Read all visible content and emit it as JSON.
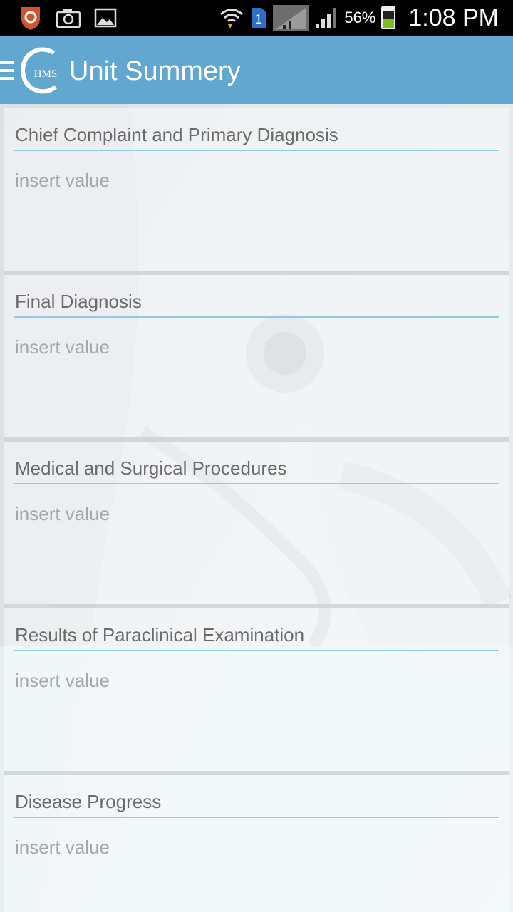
{
  "status_bar": {
    "icons_left": [
      "shield-app-icon",
      "camera-icon",
      "image-icon"
    ],
    "icons_right": [
      "wifi-icon",
      "sim-1-icon",
      "signal-icon",
      "signal-icon"
    ],
    "battery_percent": "56%",
    "battery_level": 0.56,
    "time": "1:08 PM"
  },
  "app_bar": {
    "logo_text": "HMS",
    "title": "Unit Summery"
  },
  "colors": {
    "app_bar": "#62a7d0",
    "divider": "#8fcbe8",
    "label": "#6b6b6b",
    "placeholder": "#a3a8ad"
  },
  "sections": [
    {
      "label": "Chief Complaint and Primary Diagnosis",
      "placeholder": "insert value"
    },
    {
      "label": "Final Diagnosis",
      "placeholder": "insert value"
    },
    {
      "label": "Medical and Surgical Procedures",
      "placeholder": "insert value"
    },
    {
      "label": "Results of Paraclinical Examination",
      "placeholder": "insert value"
    },
    {
      "label": "Disease Progress",
      "placeholder": "insert value"
    }
  ]
}
